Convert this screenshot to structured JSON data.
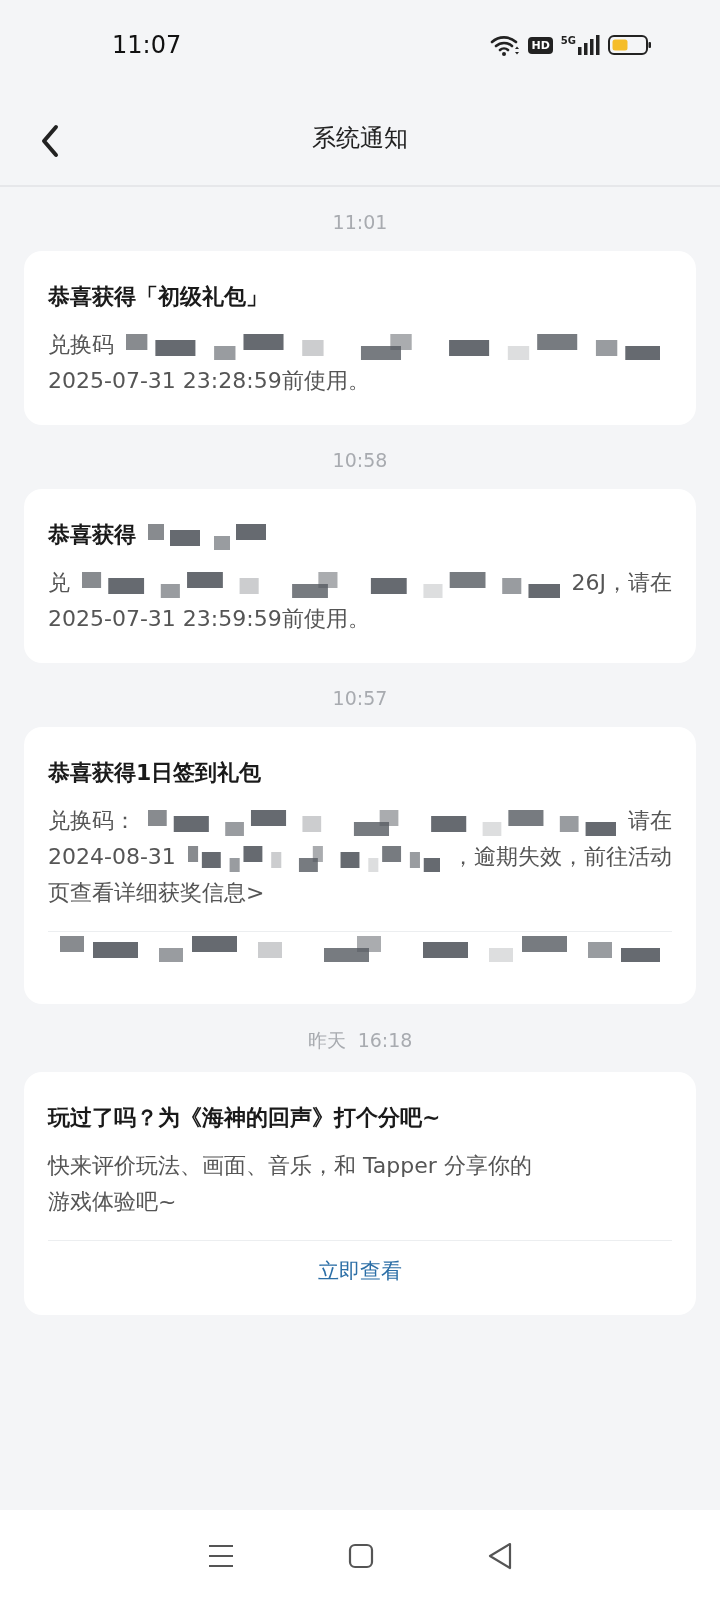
{
  "status_bar": {
    "time": "11:07",
    "hd": "HD",
    "network": "5G"
  },
  "header": {
    "title": "系统通知"
  },
  "messages": [
    {
      "time": "11:01",
      "title": [
        {
          "kind": "text",
          "text": "恭喜获得「初级礼包」"
        }
      ],
      "body": [
        [
          {
            "kind": "text",
            "text": "兑换码"
          },
          {
            "kind": "redaction"
          }
        ],
        [
          {
            "kind": "text",
            "text": "2025-07-31 23:28:59前使用。"
          }
        ]
      ]
    },
    {
      "time": "10:58",
      "title": [
        {
          "kind": "text",
          "text": "恭喜获得"
        },
        {
          "kind": "redaction"
        }
      ],
      "body": [
        [
          {
            "kind": "text",
            "text": "兑"
          },
          {
            "kind": "redaction"
          },
          {
            "kind": "text",
            "text": "26J，请在"
          }
        ],
        [
          {
            "kind": "text",
            "text": "2025-07-31 23:59:59前使用。"
          }
        ]
      ]
    },
    {
      "time": "10:57",
      "title": [
        {
          "kind": "text",
          "text": "恭喜获得1日签到礼包"
        }
      ],
      "body": [
        [
          {
            "kind": "text",
            "text": "兑换码："
          },
          {
            "kind": "redaction"
          },
          {
            "kind": "text",
            "text": "请在"
          }
        ],
        [
          {
            "kind": "text",
            "text": "2024-08-31"
          },
          {
            "kind": "redaction"
          },
          {
            "kind": "text",
            "text": "，逾期失效，前往活动"
          }
        ],
        [
          {
            "kind": "text",
            "text": "页查看详细获奖信息>"
          }
        ]
      ],
      "action": {
        "kind": "obscured"
      }
    },
    {
      "time": "昨天  16:18",
      "title": [
        {
          "kind": "text",
          "text": "玩过了吗？为《海神的回声》打个分吧~"
        }
      ],
      "body": [
        [
          {
            "kind": "text",
            "text": "快来评价玩法、画面、音乐，和 Tapper 分享你的"
          }
        ],
        [
          {
            "kind": "text",
            "text": "游戏体验吧~"
          }
        ]
      ],
      "action": {
        "kind": "link",
        "label": "立即查看"
      }
    }
  ]
}
